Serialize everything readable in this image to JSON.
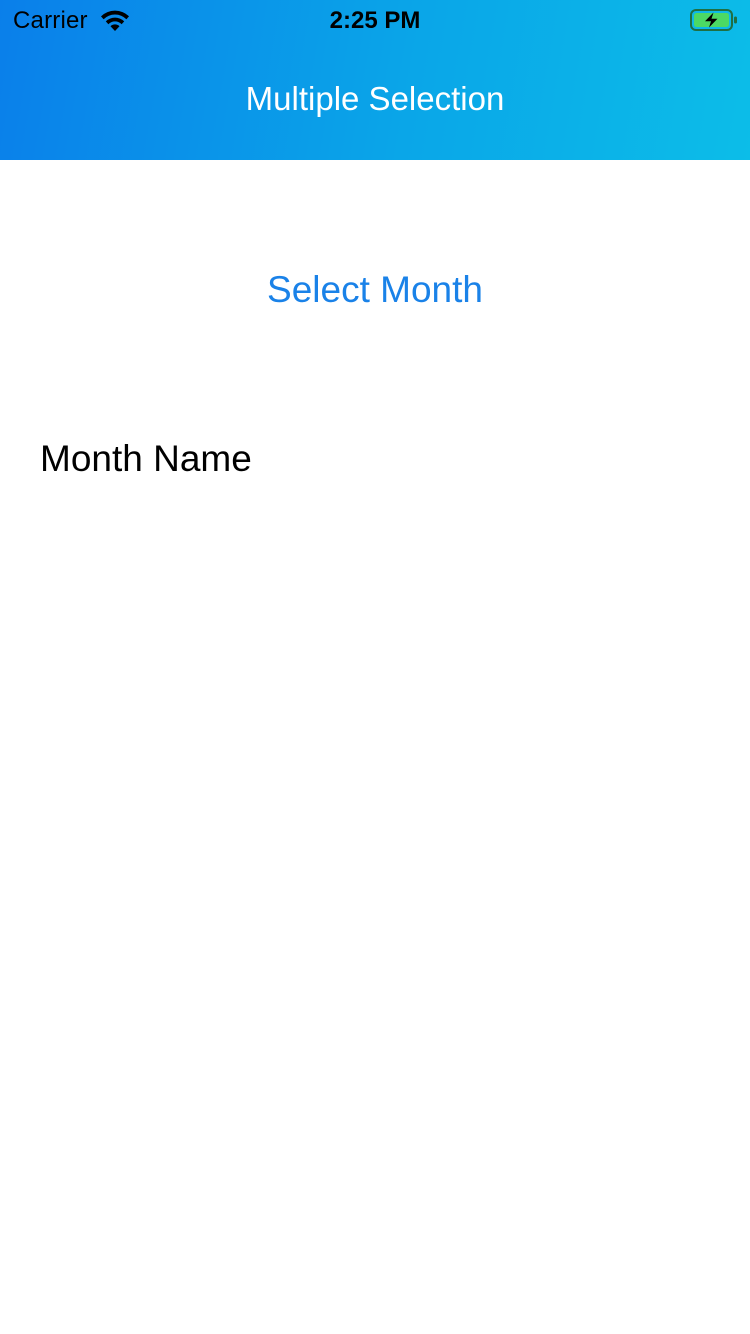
{
  "status_bar": {
    "carrier": "Carrier",
    "time": "2:25 PM",
    "wifi_icon": "wifi-icon",
    "battery_icon": "battery-charging-icon",
    "battery_color": "#4cd964"
  },
  "nav": {
    "title": "Multiple Selection",
    "gradient_start": "#0a7fea",
    "gradient_end": "#0cbde8"
  },
  "main": {
    "select_button_label": "Select Month",
    "select_button_color": "#1a82e8",
    "month_name_label": "Month Name"
  }
}
